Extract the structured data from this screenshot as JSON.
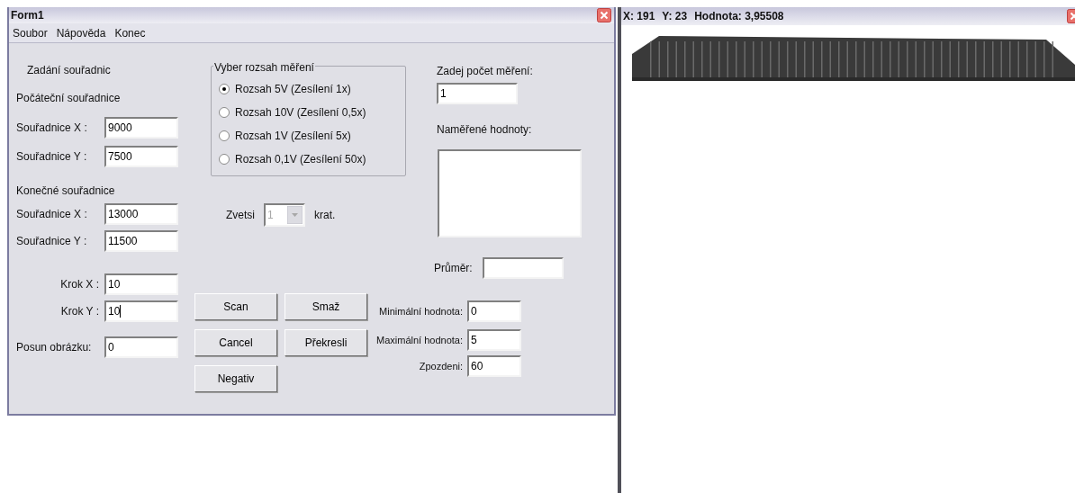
{
  "form_window": {
    "title": "Form1",
    "menu": [
      "Soubor",
      "Nápověda",
      "Konec"
    ],
    "coordinates": {
      "heading": "Zadání souřadnic",
      "start_heading": "Počáteční souřadnice",
      "start_fields": [
        {
          "label": "Souřadnice X :",
          "value": "9000"
        },
        {
          "label": "Souřadnice Y :",
          "value": "7500"
        }
      ],
      "end_heading": "Konečné souřadnice",
      "end_fields": [
        {
          "label": "Souřadnice X :",
          "value": "13000"
        },
        {
          "label": "Souřadnice Y :",
          "value": "11500"
        }
      ],
      "step_fields": [
        {
          "label": "Krok X :",
          "value": "10",
          "focused": false
        },
        {
          "label": "Krok Y :",
          "value": "10",
          "focused": true
        }
      ],
      "offset_field": {
        "label": "Posun obrázku:",
        "value": "0"
      }
    },
    "range_group": {
      "title": "Vyber rozsah měření",
      "options": [
        {
          "label": "Rozsah 5V (Zesílení 1x)",
          "selected": true
        },
        {
          "label": "Rozsah 10V (Zesílení 0,5x)",
          "selected": false
        },
        {
          "label": "Rozsah 1V (Zesílení 5x)",
          "selected": false
        },
        {
          "label": "Rozsah 0,1V (Zesílení 50x)",
          "selected": false
        }
      ]
    },
    "zoom": {
      "label": "Zvetsi",
      "value": "1",
      "disabled": true,
      "suffix": "krat."
    },
    "buttons": [
      "Scan",
      "Smaž",
      "Cancel",
      "Překresli",
      "Negativ"
    ],
    "count": {
      "label": "Zadej počet měření:",
      "value": "1"
    },
    "measured": {
      "label": "Naměřené hodnoty:"
    },
    "average": {
      "label": "Průměr:"
    },
    "limits": [
      {
        "label": "Minimální hodnota:",
        "value": "0"
      },
      {
        "label": "Maximální hodnota:",
        "value": "5"
      },
      {
        "label": "Zpozdeni:",
        "value": "60"
      }
    ]
  },
  "image_window": {
    "title_parts": [
      "X: 191",
      "Y: 23",
      "Hodnota: 3,95508"
    ]
  }
}
